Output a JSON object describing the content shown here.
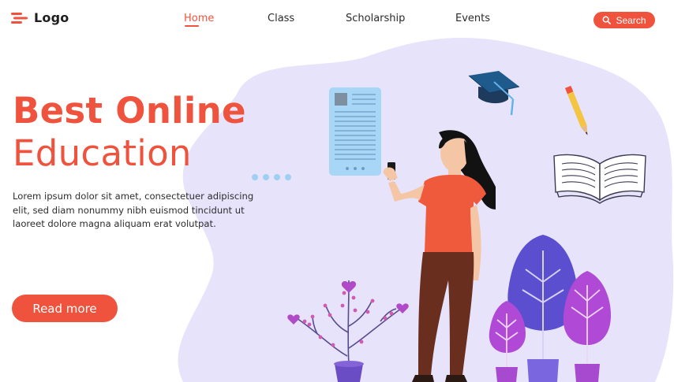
{
  "header": {
    "logo_text": "Logo",
    "nav": [
      {
        "label": "Home",
        "active": true
      },
      {
        "label": "Class",
        "active": false
      },
      {
        "label": "Scholarship",
        "active": false
      },
      {
        "label": "Events",
        "active": false
      }
    ],
    "search_label": "Search"
  },
  "hero": {
    "title_line1": "Best Online",
    "title_line2": "Education",
    "description": "Lorem ipsum dolor sit amet, consectetuer adipiscing elit, sed diam nonummy nibh euismod tincidunt ut laoreet dolore magna aliquam erat volutpat.",
    "cta_label": "Read more"
  },
  "theme": {
    "accent": "#f0533d",
    "blob": "#e6e3fb",
    "purple": "#8e4bd8",
    "blue": "#5b4fd0",
    "text": "#2b2b2b"
  },
  "icons": [
    "menu-logo-icon",
    "search-icon",
    "graduation-cap-icon",
    "pencil-icon",
    "open-book-icon",
    "document-icon"
  ]
}
